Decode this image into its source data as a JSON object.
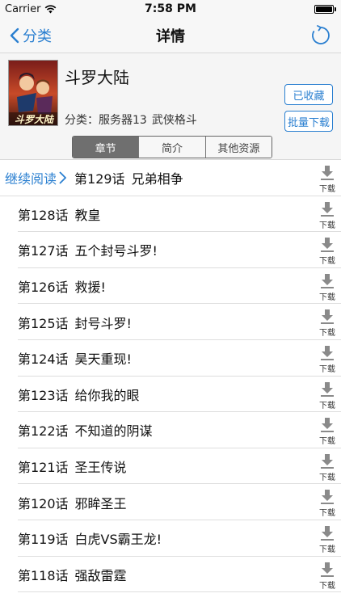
{
  "status_bar": {
    "carrier": "Carrier",
    "time": "7:58 PM",
    "battery_level": 1.0
  },
  "nav": {
    "back_label": "分类",
    "title": "详情"
  },
  "book": {
    "title": "斗罗大陆",
    "meta_label": "分类：",
    "server": "服务器13",
    "genre": "武侠格斗",
    "cover_text": "斗罗大陆"
  },
  "actions": {
    "favorite": "已收藏",
    "batch_download": "批量下载"
  },
  "tabs": [
    {
      "label": "章节",
      "active": true
    },
    {
      "label": "简介",
      "active": false
    },
    {
      "label": "其他资源",
      "active": false
    }
  ],
  "continue_reading": "继续阅读",
  "download_label": "下载",
  "chapters": [
    {
      "num": "第129话",
      "name": "兄弟相争"
    },
    {
      "num": "第128话",
      "name": "教皇"
    },
    {
      "num": "第127话",
      "name": "五个封号斗罗!"
    },
    {
      "num": "第126话",
      "name": "救援!"
    },
    {
      "num": "第125话",
      "name": "封号斗罗!"
    },
    {
      "num": "第124话",
      "name": "昊天重现!"
    },
    {
      "num": "第123话",
      "name": "给你我的眼"
    },
    {
      "num": "第122话",
      "name": "不知道的阴谋"
    },
    {
      "num": "第121话",
      "name": "圣王传说"
    },
    {
      "num": "第120话",
      "name": "邪眸圣王"
    },
    {
      "num": "第119话",
      "name": "白虎VS霸王龙!"
    },
    {
      "num": "第118话",
      "name": "强敌雷霆"
    }
  ],
  "colors": {
    "accent": "#2a7fd0",
    "segment_active": "#6f6f6f"
  }
}
